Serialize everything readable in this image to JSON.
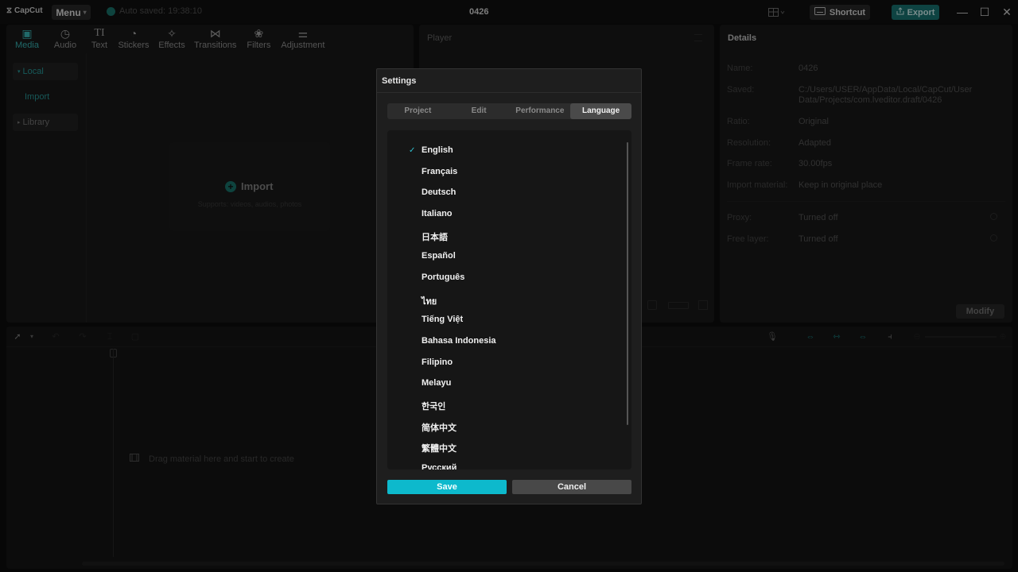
{
  "titlebar": {
    "logo": "CapCut",
    "menu_label": "Menu",
    "autosave": "Auto saved: 19:38:10",
    "project_title": "0426",
    "shortcut_label": "Shortcut",
    "export_label": "Export"
  },
  "media_toolbar": [
    {
      "label": "Media",
      "icon": "media-icon"
    },
    {
      "label": "Audio",
      "icon": "audio-icon"
    },
    {
      "label": "Text",
      "icon": "text-icon"
    },
    {
      "label": "Stickers",
      "icon": "stickers-icon"
    },
    {
      "label": "Effects",
      "icon": "effects-icon"
    },
    {
      "label": "Transitions",
      "icon": "transitions-icon"
    },
    {
      "label": "Filters",
      "icon": "filters-icon"
    },
    {
      "label": "Adjustment",
      "icon": "adjustment-icon"
    }
  ],
  "media_sidebar": {
    "local": "Local",
    "import": "Import",
    "library": "Library"
  },
  "import_area": {
    "label": "Import",
    "subtitle": "Supports: videos, audios, photos"
  },
  "player": {
    "title": "Player"
  },
  "details": {
    "title": "Details",
    "rows": [
      {
        "key": "Name:",
        "value": "0426"
      },
      {
        "key": "Saved:",
        "value": "C:/Users/USER/AppData/Local/CapCut/User Data/Projects/com.lveditor.draft/0426"
      },
      {
        "key": "Ratio:",
        "value": "Original"
      },
      {
        "key": "Resolution:",
        "value": "Adapted"
      },
      {
        "key": "Frame rate:",
        "value": "30.00fps"
      },
      {
        "key": "Import material:",
        "value": "Keep in original place"
      },
      {
        "key": "Proxy:",
        "value": "Turned off"
      },
      {
        "key": "Free layer:",
        "value": "Turned off"
      }
    ],
    "modify_label": "Modify"
  },
  "timeline": {
    "drag_hint": "Drag material here and start to create"
  },
  "settings": {
    "title": "Settings",
    "tabs": [
      "Project",
      "Edit",
      "Performance",
      "Language"
    ],
    "active_tab": "Language",
    "languages": [
      "English",
      "Français",
      "Deutsch",
      "Italiano",
      "日本語",
      "Español",
      "Português",
      "ไทย",
      "Tiếng Việt",
      "Bahasa Indonesia",
      "Filipino",
      "Melayu",
      "한국인",
      "简体中文",
      "繁體中文",
      "Русский"
    ],
    "selected_language": "English",
    "save_label": "Save",
    "cancel_label": "Cancel"
  },
  "colors": {
    "accent": "#0db9cc",
    "export_bg": "#1a7a78",
    "active_tool": "#3bbfbf"
  }
}
